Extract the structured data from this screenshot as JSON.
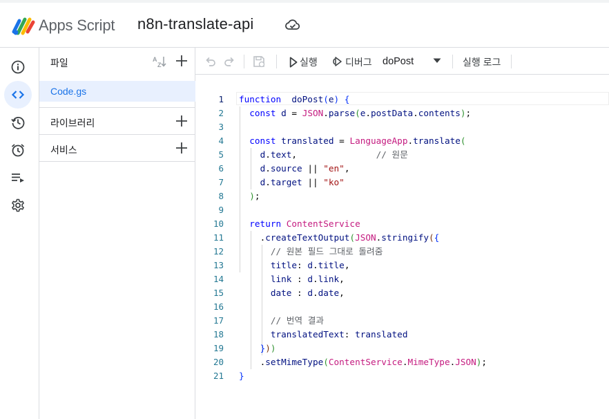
{
  "header": {
    "brand": "Apps Script",
    "project_name": "n8n-translate-api",
    "logo_icon": "apps-script-logo",
    "cloud_icon": "cloud-sync-icon"
  },
  "rail": [
    {
      "name": "overview",
      "icon": "info-icon",
      "active": false
    },
    {
      "name": "editor",
      "icon": "code-icon",
      "active": true
    },
    {
      "name": "executions",
      "icon": "history-icon",
      "active": false
    },
    {
      "name": "triggers",
      "icon": "alarm-icon",
      "active": false
    },
    {
      "name": "runs",
      "icon": "playlist-icon",
      "active": false
    },
    {
      "name": "settings",
      "icon": "gear-icon",
      "active": false
    }
  ],
  "files_panel": {
    "files_label": "파일",
    "files": [
      "Code.gs"
    ],
    "libraries_label": "라이브러리",
    "services_label": "서비스"
  },
  "toolbar": {
    "run_label": "실행",
    "debug_label": "디버그",
    "function_name": "doPost",
    "log_label": "실행 로그"
  },
  "editor": {
    "current_line": 1,
    "lines": [
      [
        [
          "kw",
          "function"
        ],
        [
          "",
          "  "
        ],
        [
          "id",
          "doPost"
        ],
        [
          "b1",
          "("
        ],
        [
          "id",
          "e"
        ],
        [
          "b1",
          ")"
        ],
        [
          "",
          " "
        ],
        [
          "b1",
          "{"
        ]
      ],
      [
        [
          "",
          ""
        ],
        [
          "kw",
          "const"
        ],
        [
          "",
          " "
        ],
        [
          "id",
          "d"
        ],
        [
          "",
          " = "
        ],
        [
          "cls",
          "JSON"
        ],
        [
          "",
          "."
        ],
        [
          "id",
          "parse"
        ],
        [
          "b2",
          "("
        ],
        [
          "id",
          "e"
        ],
        [
          "",
          "."
        ],
        [
          "id",
          "postData"
        ],
        [
          "",
          "."
        ],
        [
          "id",
          "contents"
        ],
        [
          "b2",
          ")"
        ],
        [
          "",
          ";"
        ]
      ],
      [],
      [
        [
          "",
          ""
        ],
        [
          "kw",
          "const"
        ],
        [
          "",
          " "
        ],
        [
          "id",
          "translated"
        ],
        [
          "",
          " = "
        ],
        [
          "cls",
          "LanguageApp"
        ],
        [
          "",
          "."
        ],
        [
          "id",
          "translate"
        ],
        [
          "b2",
          "("
        ]
      ],
      [
        [
          "",
          ""
        ],
        [
          "id",
          "d"
        ],
        [
          "",
          "."
        ],
        [
          "id",
          "text"
        ],
        [
          "",
          ",               "
        ],
        [
          "cmt",
          "// 원문"
        ]
      ],
      [
        [
          "",
          ""
        ],
        [
          "id",
          "d"
        ],
        [
          "",
          "."
        ],
        [
          "id",
          "source"
        ],
        [
          "",
          " || "
        ],
        [
          "str",
          "\"en\""
        ],
        [
          "",
          ","
        ]
      ],
      [
        [
          "",
          ""
        ],
        [
          "id",
          "d"
        ],
        [
          "",
          "."
        ],
        [
          "id",
          "target"
        ],
        [
          "",
          " || "
        ],
        [
          "str",
          "\"ko\""
        ]
      ],
      [
        [
          "",
          ""
        ],
        [
          "b2",
          ")"
        ],
        [
          "",
          ";"
        ]
      ],
      [],
      [
        [
          "",
          ""
        ],
        [
          "kw",
          "return"
        ],
        [
          "",
          " "
        ],
        [
          "cls",
          "ContentService"
        ]
      ],
      [
        [
          "",
          ""
        ],
        [
          "",
          ""
        ],
        [
          "",
          "."
        ],
        [
          "id",
          "createTextOutput"
        ],
        [
          "b2",
          "("
        ],
        [
          "cls",
          "JSON"
        ],
        [
          "",
          "."
        ],
        [
          "id",
          "stringify"
        ],
        [
          "b3",
          "("
        ],
        [
          "b1",
          "{"
        ]
      ],
      [
        [
          "",
          ""
        ],
        [
          "cmt",
          "// 원본 필드 그대로 돌려줌"
        ]
      ],
      [
        [
          "",
          ""
        ],
        [
          "id",
          "title"
        ],
        [
          "",
          ": "
        ],
        [
          "id",
          "d"
        ],
        [
          "",
          "."
        ],
        [
          "id",
          "title"
        ],
        [
          "",
          ","
        ]
      ],
      [
        [
          "",
          ""
        ],
        [
          "id",
          "link"
        ],
        [
          "",
          " : "
        ],
        [
          "id",
          "d"
        ],
        [
          "",
          "."
        ],
        [
          "id",
          "link"
        ],
        [
          "",
          ","
        ]
      ],
      [
        [
          "",
          ""
        ],
        [
          "id",
          "date"
        ],
        [
          "",
          " : "
        ],
        [
          "id",
          "d"
        ],
        [
          "",
          "."
        ],
        [
          "id",
          "date"
        ],
        [
          "",
          ","
        ]
      ],
      [],
      [
        [
          "",
          ""
        ],
        [
          "cmt",
          "// 번역 결과"
        ]
      ],
      [
        [
          "",
          ""
        ],
        [
          "id",
          "translatedText"
        ],
        [
          "",
          ": "
        ],
        [
          "id",
          "translated"
        ]
      ],
      [
        [
          "",
          ""
        ],
        [
          "b1",
          "}"
        ],
        [
          "b3",
          ")"
        ],
        [
          "b2",
          ")"
        ]
      ],
      [
        [
          "",
          ""
        ],
        [
          "",
          "."
        ],
        [
          "id",
          "setMimeType"
        ],
        [
          "b2",
          "("
        ],
        [
          "cls",
          "ContentService"
        ],
        [
          "",
          "."
        ],
        [
          "cls",
          "MimeType"
        ],
        [
          "",
          "."
        ],
        [
          "cls",
          "JSON"
        ],
        [
          "b2",
          ")"
        ],
        [
          "",
          ";"
        ]
      ],
      [
        [
          "b1",
          "}"
        ]
      ]
    ]
  }
}
